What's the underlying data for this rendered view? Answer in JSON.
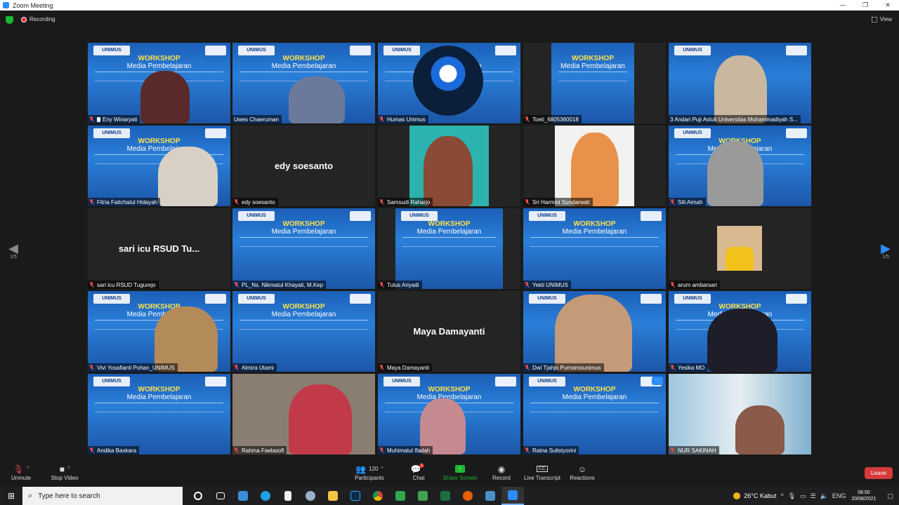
{
  "window": {
    "title": "Zoom Meeting"
  },
  "topbar": {
    "recording_label": "Recording",
    "view_label": "View"
  },
  "pager": {
    "left": "1/5",
    "right": "1/5"
  },
  "workshop": {
    "title": "WORKSHOP",
    "subtitle": "Media Pembelajaran",
    "logo": "UNIMUS"
  },
  "participants": [
    {
      "name": "Eny Winaryati"
    },
    {
      "name": "Uwes Chaeruman"
    },
    {
      "name": "Humas Unimus"
    },
    {
      "name": "Toeti_6805360018"
    },
    {
      "name": "3 Andari Puji Astuti Universitas Muhammadiyah S..."
    },
    {
      "name": "Fitria Fatichatul Hidayah"
    },
    {
      "name": "edy soesanto",
      "display": "edy soesanto"
    },
    {
      "name": "Samsudi Raharjo"
    },
    {
      "name": "Sri Harmini Sundarwati"
    },
    {
      "name": "Siti Aimah"
    },
    {
      "name": "sari icu RSUD Tugurejo",
      "display": "sari icu RSUD Tu..."
    },
    {
      "name": "PL_Ns. Nikmatul Khayati, M.Kep"
    },
    {
      "name": "Tulus Ariyadi"
    },
    {
      "name": "Yekti UNIMUS"
    },
    {
      "name": "arum ambarsari"
    },
    {
      "name": "Vivi Yosafianti Pohan_UNIMUS"
    },
    {
      "name": "Almira Utami"
    },
    {
      "name": "Maya Damayanti",
      "display": "Maya Damayanti"
    },
    {
      "name": "Dwi Tjahjo Purnomounimus"
    },
    {
      "name": "Yesika MO"
    },
    {
      "name": "Andika Baskara"
    },
    {
      "name": "Rahma Faelasofi"
    },
    {
      "name": "Muhimatul Ifadah"
    },
    {
      "name": "Ratna Sulistyorini"
    },
    {
      "name": "NUR SAKINAH"
    }
  ],
  "toolbar": {
    "unmute": "Unmute",
    "stop_video": "Stop Video",
    "participants": "Participants",
    "participants_count": "120",
    "chat": "Chat",
    "chat_badge": "1",
    "share_screen": "Share Screen",
    "record": "Record",
    "live_transcript": "Live Transcript",
    "reactions": "Reactions",
    "leave": "Leave"
  },
  "taskbar": {
    "search_placeholder": "Type here to search",
    "weather": "26°C  Kabut",
    "lang": "ENG",
    "time": "08.50",
    "date": "20/08/2021"
  },
  "colors": {
    "zoom_blue": "#2d8cff",
    "share_green": "#1bb934",
    "leave_red": "#d63b3b",
    "active_speaker": "#d8e05a"
  }
}
